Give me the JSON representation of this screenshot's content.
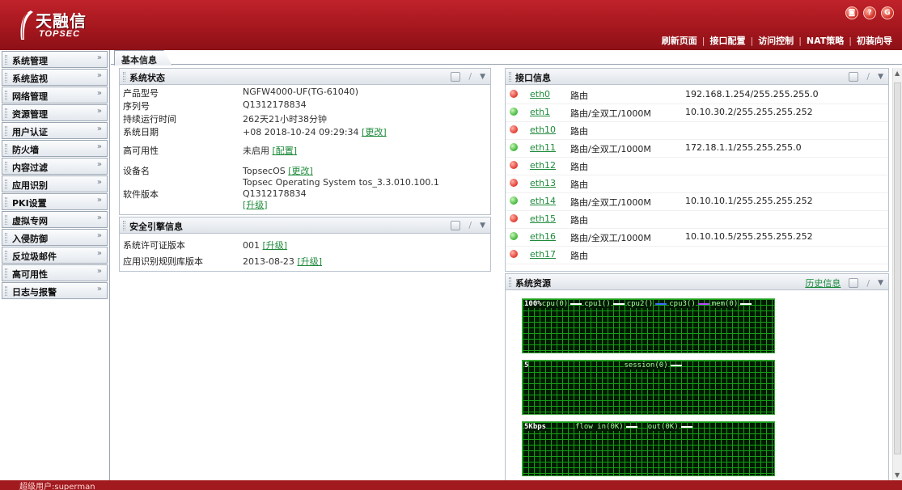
{
  "header": {
    "logo_cn": "天融信",
    "logo_en": "TOPSEC",
    "icons": [
      "help-icon",
      "info-icon",
      "logout-icon"
    ],
    "icon_glyphs": [
      "◙",
      "?",
      "G"
    ],
    "links": [
      "刷新页面",
      "接口配置",
      "访问控制",
      "NAT策略",
      "初装向导"
    ]
  },
  "sidebar": {
    "items": [
      {
        "label": "系统管理"
      },
      {
        "label": "系统监视"
      },
      {
        "label": "网络管理"
      },
      {
        "label": "资源管理"
      },
      {
        "label": "用户认证"
      },
      {
        "label": "防火墙"
      },
      {
        "label": "内容过滤"
      },
      {
        "label": "应用识别"
      },
      {
        "label": "PKI设置"
      },
      {
        "label": "虚拟专网"
      },
      {
        "label": "入侵防御"
      },
      {
        "label": "反垃圾邮件"
      },
      {
        "label": "高可用性"
      },
      {
        "label": "日志与报警"
      }
    ]
  },
  "tabs": [
    {
      "label": "基本信息"
    }
  ],
  "system_status": {
    "title": "系统状态",
    "rows": [
      {
        "k": "产品型号",
        "v": "NGFW4000-UF(TG-61040)",
        "link": ""
      },
      {
        "k": "序列号",
        "v": "Q1312178834",
        "link": ""
      },
      {
        "k": "持续运行时间",
        "v": "262天21小时38分钟",
        "link": ""
      },
      {
        "k": "系统日期",
        "v": "+08 2018-10-24 09:29:34",
        "link": "[更改]"
      },
      {
        "k": "高可用性",
        "v": "未启用",
        "link": "[配置]"
      },
      {
        "k": "设备名",
        "v": "TopsecOS",
        "link": "[更改]"
      },
      {
        "k": "软件版本",
        "v": "Topsec Operating System tos_3.3.010.100.1 Q1312178834",
        "link": "[升级]"
      }
    ]
  },
  "security_engine": {
    "title": "安全引擎信息",
    "rows": [
      {
        "k": "系统许可证版本",
        "v": "001",
        "link": "[升级]"
      },
      {
        "k": "应用识别规则库版本",
        "v": "2013-08-23",
        "link": "[升级]"
      }
    ]
  },
  "interfaces": {
    "title": "接口信息",
    "rows": [
      {
        "name": "eth0",
        "mode": "路由",
        "ip": "192.168.1.254/255.255.255.0",
        "status": "red"
      },
      {
        "name": "eth1",
        "mode": "路由/全双工/1000M",
        "ip": "10.10.30.2/255.255.255.252",
        "status": "green"
      },
      {
        "name": "eth10",
        "mode": "路由",
        "ip": "",
        "status": "red"
      },
      {
        "name": "eth11",
        "mode": "路由/全双工/1000M",
        "ip": "172.18.1.1/255.255.255.0",
        "status": "green"
      },
      {
        "name": "eth12",
        "mode": "路由",
        "ip": "",
        "status": "red"
      },
      {
        "name": "eth13",
        "mode": "路由",
        "ip": "",
        "status": "red"
      },
      {
        "name": "eth14",
        "mode": "路由/全双工/1000M",
        "ip": "10.10.10.1/255.255.255.252",
        "status": "green"
      },
      {
        "name": "eth15",
        "mode": "路由",
        "ip": "",
        "status": "red"
      },
      {
        "name": "eth16",
        "mode": "路由/全双工/1000M",
        "ip": "10.10.10.5/255.255.255.252",
        "status": "green"
      },
      {
        "name": "eth17",
        "mode": "路由",
        "ip": "",
        "status": "red"
      }
    ]
  },
  "resources": {
    "title": "系统资源",
    "history_link": "历史信息",
    "graphs": [
      {
        "axis": "100%",
        "legend": [
          {
            "text": "cpu(0)",
            "color": "#ffffff"
          },
          {
            "text": "cpu1()",
            "color": "#ffffff"
          },
          {
            "text": "cpu2()",
            "color": "#3b6cff"
          },
          {
            "text": "cpu3()",
            "color": "#b54aff"
          },
          {
            "text": "mem(0)",
            "color": "#ffffff"
          }
        ]
      },
      {
        "axis": "5",
        "legend": [
          {
            "text": "session(0)",
            "color": "#ffffff"
          }
        ]
      },
      {
        "axis": "5Kbps",
        "legend": [
          {
            "text": "flow in(0K)",
            "color": "#ffffff"
          },
          {
            "text": "out(0K)",
            "color": "#ffffff"
          }
        ]
      }
    ]
  },
  "status_bar": {
    "text": "超级用户:superman"
  }
}
